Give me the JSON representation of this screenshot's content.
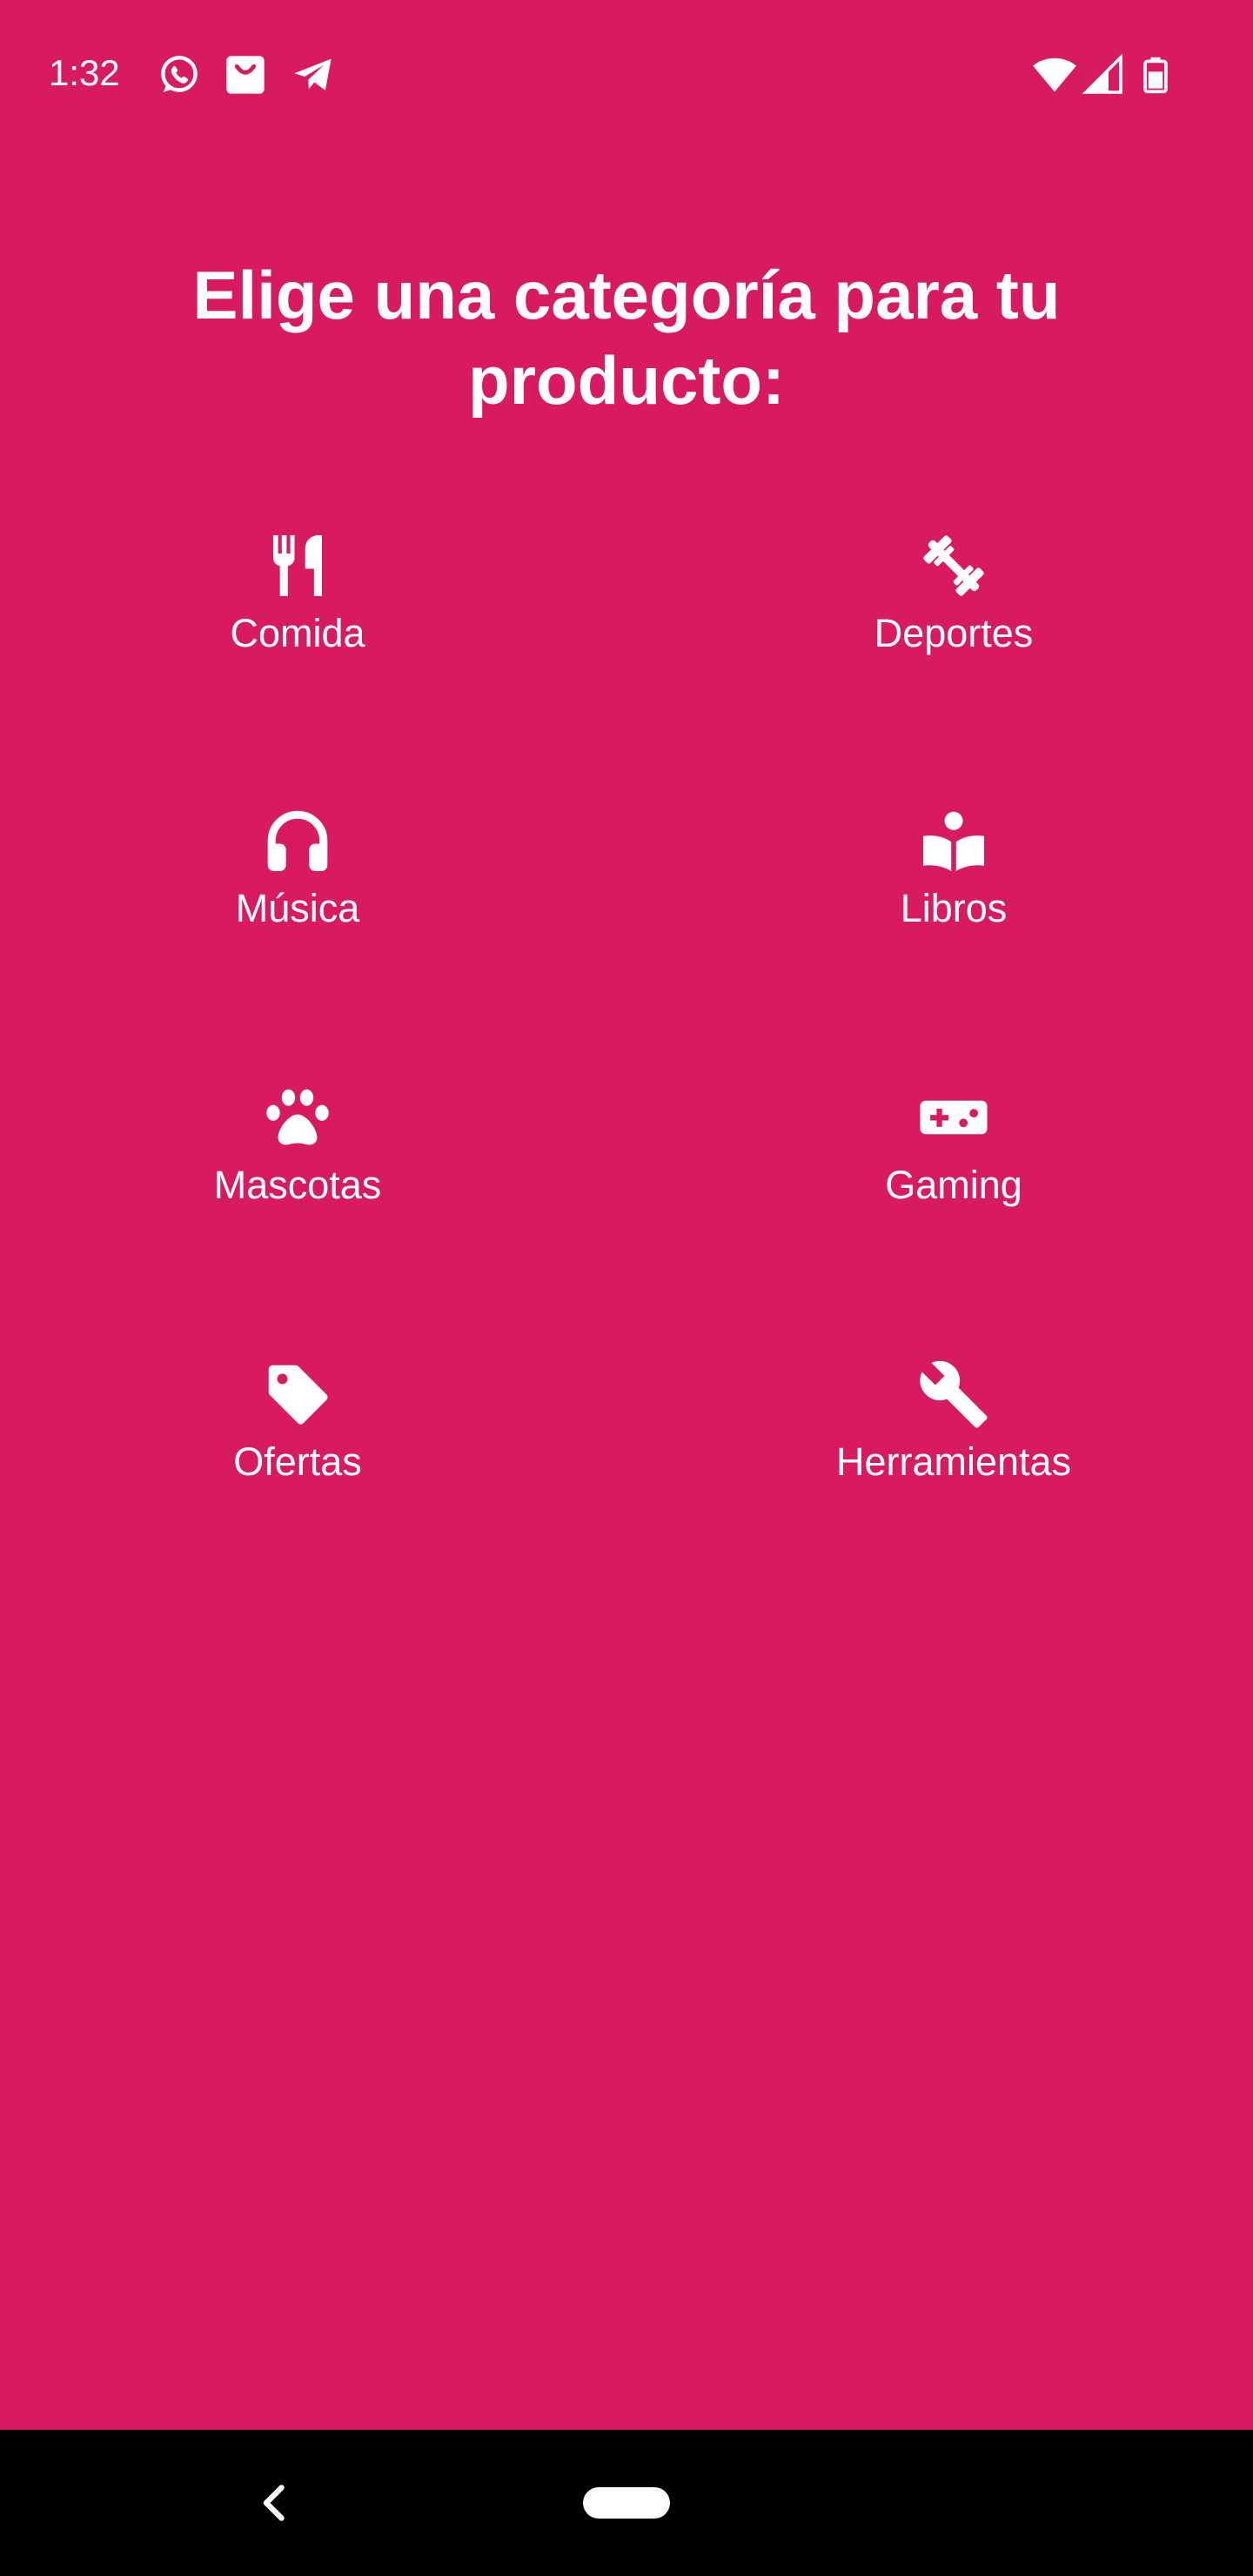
{
  "theme": {
    "background": "#D81B60",
    "foreground": "#FFFFFF",
    "nav_background": "#000000"
  },
  "status_bar": {
    "time": "1:32",
    "left_icons": [
      "whatsapp-icon",
      "shopping-bag-icon",
      "telegram-icon"
    ],
    "right_icons": [
      "wifi-icon",
      "cell-signal-icon",
      "battery-icon"
    ]
  },
  "heading": "Elige una categoría para tu producto:",
  "categories": [
    {
      "label": "Comida",
      "icon": "fork-knife-icon"
    },
    {
      "label": "Deportes",
      "icon": "dumbbell-icon"
    },
    {
      "label": "Música",
      "icon": "headphones-icon"
    },
    {
      "label": "Libros",
      "icon": "book-reader-icon"
    },
    {
      "label": "Mascotas",
      "icon": "paw-icon"
    },
    {
      "label": "Gaming",
      "icon": "gamepad-icon"
    },
    {
      "label": "Ofertas",
      "icon": "tag-icon"
    },
    {
      "label": "Herramientas",
      "icon": "wrench-icon"
    }
  ],
  "nav_bar": {
    "back_icon": "back-chevron-icon",
    "home_icon": "home-pill-icon"
  }
}
